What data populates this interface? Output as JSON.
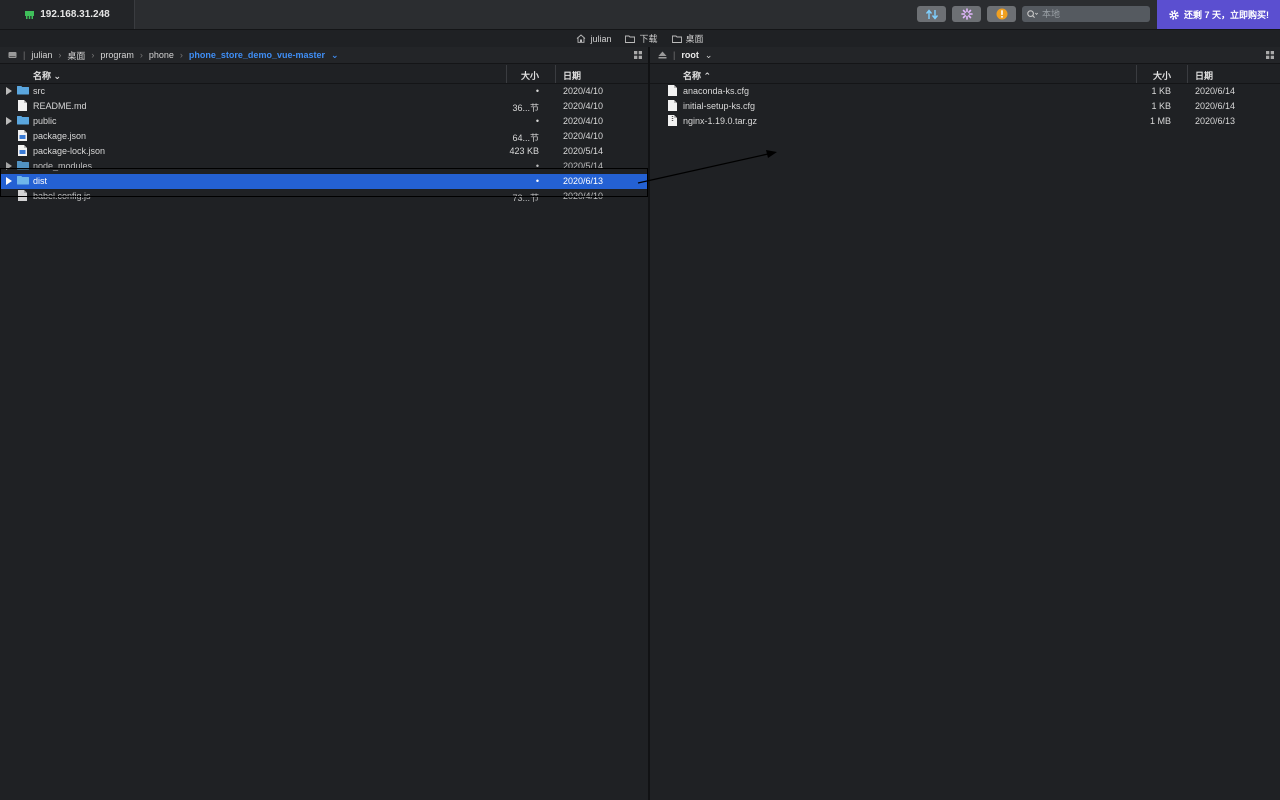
{
  "app": {
    "host": "192.168.31.248",
    "search_placeholder": "本地",
    "promo_text": "还剩 7 天，立即购买!"
  },
  "bookmarks": [
    {
      "label": "julian",
      "icon": "home-icon"
    },
    {
      "label": "下载",
      "icon": "folder-icon"
    },
    {
      "label": "桌面",
      "icon": "folder-icon"
    }
  ],
  "left": {
    "breadcrumb": [
      "julian",
      "桌面",
      "program",
      "phone",
      "phone_store_demo_vue-master"
    ],
    "headers": {
      "name": "名称",
      "size": "大小",
      "date": "日期"
    },
    "rows": [
      {
        "name": "src",
        "type": "folder",
        "size": "•",
        "date": "2020/4/10",
        "expandable": true
      },
      {
        "name": "README.md",
        "type": "file",
        "size": "36...节",
        "date": "2020/4/10",
        "expandable": false
      },
      {
        "name": "public",
        "type": "folder",
        "size": "•",
        "date": "2020/4/10",
        "expandable": true
      },
      {
        "name": "package.json",
        "type": "file",
        "size": "64...节",
        "date": "2020/4/10",
        "expandable": false
      },
      {
        "name": "package-lock.json",
        "type": "file",
        "size": "423 KB",
        "date": "2020/5/14",
        "expandable": false
      },
      {
        "name": "node_modules",
        "type": "folder",
        "size": "•",
        "date": "2020/5/14",
        "expandable": true
      },
      {
        "name": "dist",
        "type": "folder",
        "size": "•",
        "date": "2020/6/13",
        "expandable": true,
        "selected": true
      },
      {
        "name": "babel.config.js",
        "type": "file",
        "size": "73...节",
        "date": "2020/4/10",
        "expandable": false
      }
    ]
  },
  "right": {
    "breadcrumb": [
      "root"
    ],
    "headers": {
      "name": "名称",
      "size": "大小",
      "date": "日期"
    },
    "rows": [
      {
        "name": "anaconda-ks.cfg",
        "type": "file",
        "size": "1 KB",
        "date": "2020/6/14"
      },
      {
        "name": "initial-setup-ks.cfg",
        "type": "file",
        "size": "1 KB",
        "date": "2020/6/14"
      },
      {
        "name": "nginx-1.19.0.tar.gz",
        "type": "file",
        "size": "1 MB",
        "date": "2020/6/13"
      }
    ]
  },
  "colors": {
    "accent": "#2461d3",
    "breadcrumb_active": "#3f8ef5",
    "folder": "#5aa6de",
    "promo": "#5b4fd0"
  }
}
